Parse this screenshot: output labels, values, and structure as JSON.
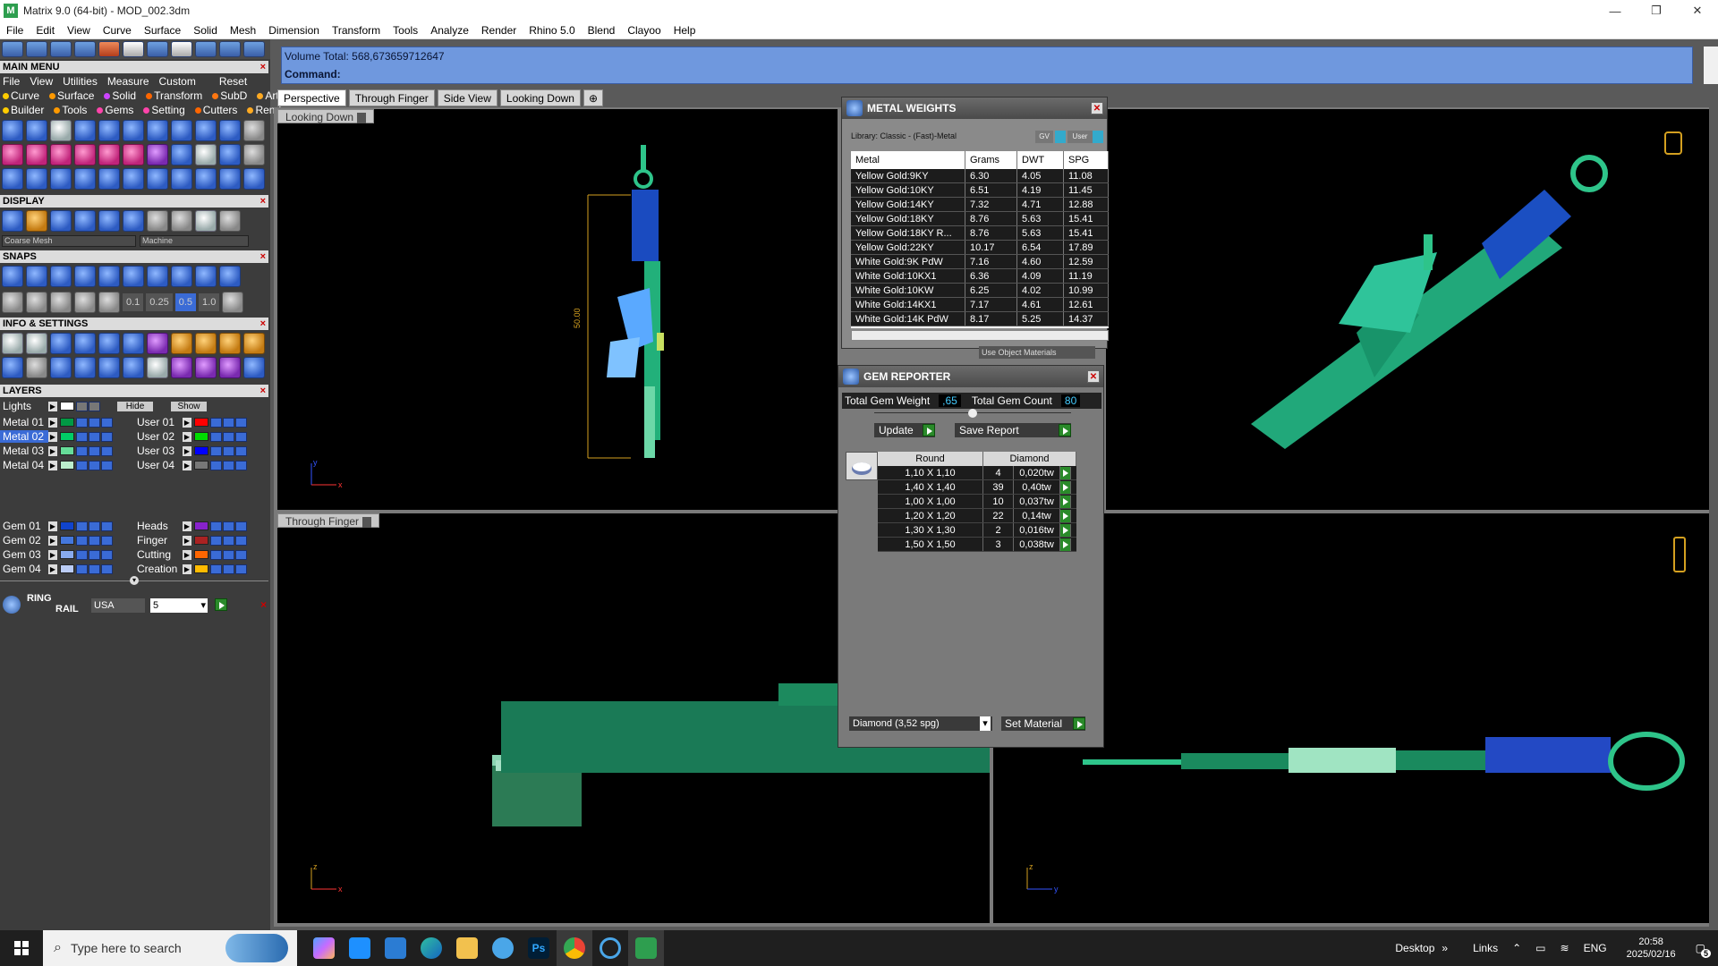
{
  "window": {
    "title": "Matrix 9.0 (64-bit) - MOD_002.3dm",
    "app_icon": "matrix-logo-icon",
    "controls": [
      "minimize",
      "restore",
      "close"
    ]
  },
  "menu": [
    "File",
    "Edit",
    "View",
    "Curve",
    "Surface",
    "Solid",
    "Mesh",
    "Dimension",
    "Transform",
    "Tools",
    "Analyze",
    "Render",
    "Rhino 5.0",
    "Blend",
    "Clayoo",
    "Help"
  ],
  "left_panel": {
    "main_menu": {
      "title": "MAIN MENU",
      "row1": [
        "File",
        "View",
        "Utilities",
        "Measure",
        "Custom",
        "Reset"
      ],
      "row2": [
        "Curve",
        "Surface",
        "Solid",
        "Transform",
        "SubD",
        "Art"
      ],
      "row3": [
        "Builder",
        "Tools",
        "Gems",
        "Setting",
        "Cutters",
        "Render"
      ]
    },
    "display": {
      "title": "DISPLAY",
      "mesh_select": "Coarse Mesh",
      "material_select": "Machine"
    },
    "snaps": {
      "title": "SNAPS",
      "values": [
        "0.1",
        "0.25",
        "0.5",
        "1.0"
      ]
    },
    "info_settings": {
      "title": "INFO & SETTINGS"
    },
    "layers": {
      "title": "LAYERS",
      "lights_label": "Lights",
      "hide_label": "Hide",
      "show_label": "Show",
      "left_layers": [
        {
          "name": "Metal 01",
          "color": "#009944",
          "selected": false
        },
        {
          "name": "Metal 02",
          "color": "#00cc66",
          "selected": true
        },
        {
          "name": "Metal 03",
          "color": "#66dd99",
          "selected": false
        },
        {
          "name": "Metal 04",
          "color": "#bbeecc",
          "selected": false
        },
        {
          "name": "Gem 01",
          "color": "#1144cc",
          "selected": false
        },
        {
          "name": "Gem 02",
          "color": "#4477dd",
          "selected": false
        },
        {
          "name": "Gem 03",
          "color": "#88aaee",
          "selected": false
        },
        {
          "name": "Gem 04",
          "color": "#bbccf5",
          "selected": false
        }
      ],
      "right_layers": [
        {
          "name": "User 01",
          "color": "#ff0000"
        },
        {
          "name": "User 02",
          "color": "#00dd00"
        },
        {
          "name": "User 03",
          "color": "#0000ff"
        },
        {
          "name": "User 04",
          "color": "#777777"
        },
        {
          "name": "Heads",
          "color": "#8822cc"
        },
        {
          "name": "Finger",
          "color": "#aa2222"
        },
        {
          "name": "Cutting",
          "color": "#ff6600"
        },
        {
          "name": "Creation",
          "color": "#ffbb00"
        }
      ]
    },
    "ring_rail": {
      "label1": "RING",
      "label2": "RAIL",
      "standard": "USA",
      "size": "5"
    }
  },
  "command": {
    "volume_line": "Volume Total: 568,673659712647",
    "prompt": "Command:"
  },
  "viewport_tabs": [
    "Perspective",
    "Through Finger",
    "Side View",
    "Looking Down"
  ],
  "viewports": {
    "top_left_label": "Looking Down",
    "bottom_left_label": "Through Finger",
    "dimension_value": "50.00"
  },
  "metal_weights": {
    "title": "METAL WEIGHTS",
    "library": "Library: Classic - (Fast)-Metal",
    "gv_label": "GV",
    "user_label": "User",
    "columns": [
      "Metal",
      "Grams",
      "DWT",
      "SPG"
    ],
    "rows": [
      [
        "Yellow Gold:9KY",
        "6.30",
        "4.05",
        "11.08"
      ],
      [
        "Yellow Gold:10KY",
        "6.51",
        "4.19",
        "11.45"
      ],
      [
        "Yellow Gold:14KY",
        "7.32",
        "4.71",
        "12.88"
      ],
      [
        "Yellow Gold:18KY",
        "8.76",
        "5.63",
        "15.41"
      ],
      [
        "Yellow Gold:18KY R...",
        "8.76",
        "5.63",
        "15.41"
      ],
      [
        "Yellow Gold:22KY",
        "10.17",
        "6.54",
        "17.89"
      ],
      [
        "White Gold:9K PdW",
        "7.16",
        "4.60",
        "12.59"
      ],
      [
        "White Gold:10KX1",
        "6.36",
        "4.09",
        "11.19"
      ],
      [
        "White Gold:10KW",
        "6.25",
        "4.02",
        "10.99"
      ],
      [
        "White Gold:14KX1",
        "7.17",
        "4.61",
        "12.61"
      ],
      [
        "White Gold:14K PdW",
        "8.17",
        "5.25",
        "14.37"
      ]
    ],
    "use_object_materials": "Use Object Materials"
  },
  "gem_reporter": {
    "title": "GEM REPORTER",
    "total_weight_label": "Total Gem Weight",
    "total_weight_value": ",65",
    "total_count_label": "Total Gem Count",
    "total_count_value": "80",
    "update_label": "Update",
    "save_report_label": "Save Report",
    "columns": [
      "Round",
      "Diamond"
    ],
    "rows": [
      [
        "1,10 X 1,10",
        "4",
        "0,020tw"
      ],
      [
        "1,40 X 1,40",
        "39",
        "0,40tw"
      ],
      [
        "1,00 X 1,00",
        "10",
        "0,037tw"
      ],
      [
        "1,20 X 1,20",
        "22",
        "0,14tw"
      ],
      [
        "1,30 X 1,30",
        "2",
        "0,016tw"
      ],
      [
        "1,50 X 1,50",
        "3",
        "0,038tw"
      ]
    ],
    "material_select": "Diamond    (3,52 spg)",
    "set_material_label": "Set Material"
  },
  "taskbar": {
    "search_placeholder": "Type here to search",
    "desktop_label": "Desktop",
    "links_label": "Links",
    "language": "ENG",
    "time": "20:58",
    "date": "2025/02/16",
    "notification_count": "5"
  }
}
